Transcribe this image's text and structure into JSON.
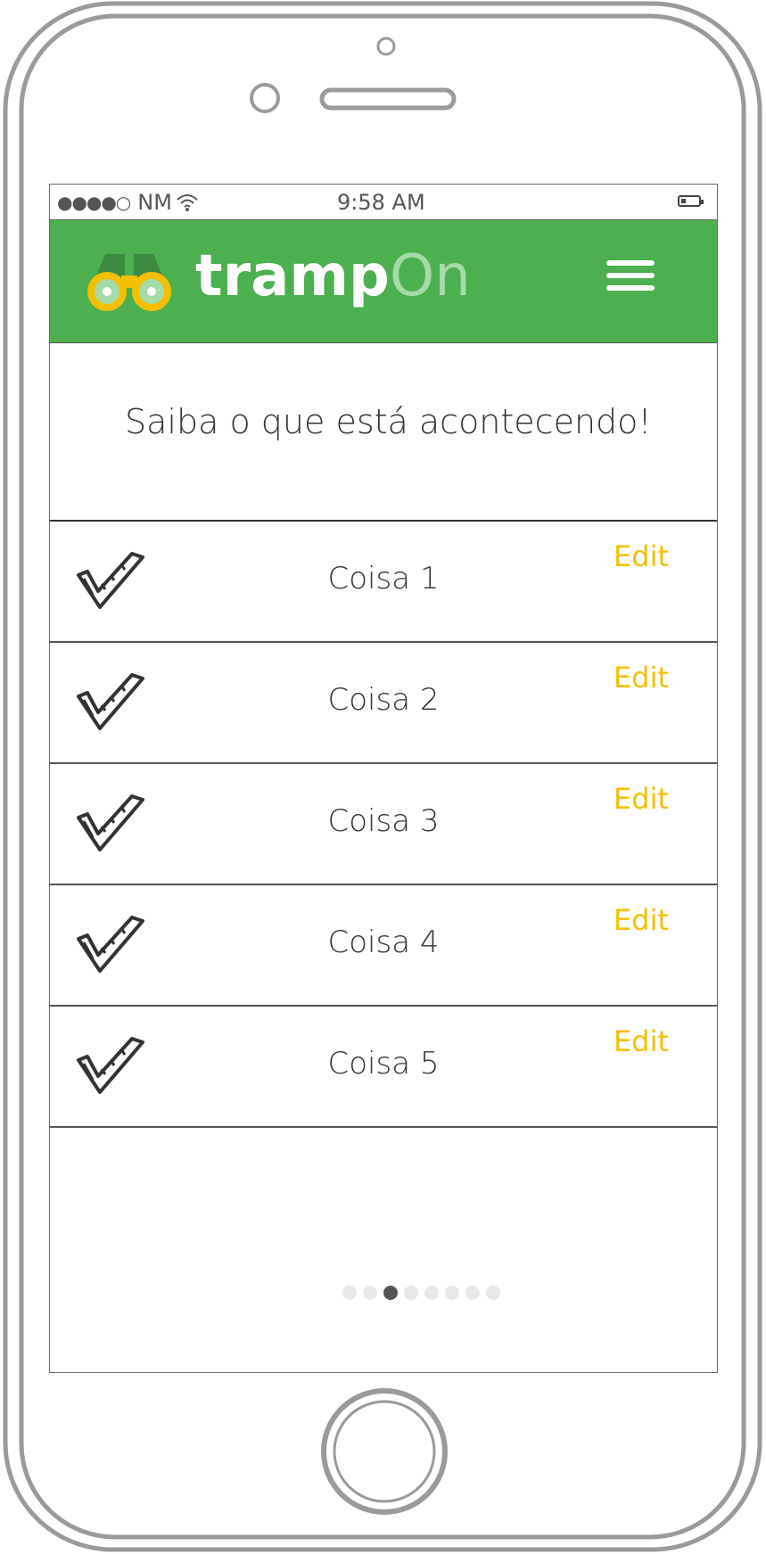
{
  "status_bar": {
    "signal": "●●●●○",
    "carrier": "NM",
    "time": "9:58 AM"
  },
  "header": {
    "logo_bold": "tramp",
    "logo_light": "On",
    "background_color": "#4caf50"
  },
  "intro": {
    "text": "Saiba o que está acontecendo!"
  },
  "items": [
    {
      "label": "Coisa 1",
      "action": "Edit"
    },
    {
      "label": "Coisa 2",
      "action": "Edit"
    },
    {
      "label": "Coisa 3",
      "action": "Edit"
    },
    {
      "label": "Coisa 4",
      "action": "Edit"
    },
    {
      "label": "Coisa 5",
      "action": "Edit"
    }
  ],
  "pager": {
    "total": 8,
    "active_index": 2
  },
  "colors": {
    "edit": "#f5c000",
    "brand_green": "#4caf50"
  }
}
